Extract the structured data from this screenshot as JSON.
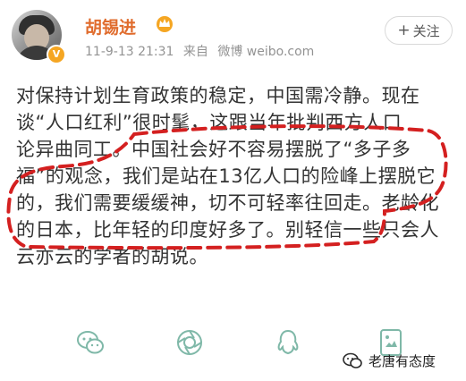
{
  "author": {
    "name": "胡锡进",
    "verified_icon": "verified-badge-icon",
    "vip_icon": "crown-icon"
  },
  "meta": {
    "timestamp": "11-9-13 21:31",
    "source_prefix": "来自",
    "source": "微博 weibo.com"
  },
  "follow_button": {
    "icon": "+",
    "label": "关注"
  },
  "post": {
    "lines": [
      "对保持计划生育政策的稳定，中国需冷静。现在",
      "谈“人口红利”很时髦，这跟当年批判西方人口",
      "论异曲同工。中国社会好不容易摆脱了“多子多",
      "福”的观念，我们是站在13亿人口的险峰上摆脱它",
      "的，我们需要缓缓神，切不可轻率往回走。老龄化",
      "的日本，比年轻的印度好多了。别轻信一些只会人",
      "云亦云的学者的胡说。"
    ]
  },
  "share_icons": [
    "wechat-icon",
    "moments-icon",
    "qq-icon",
    "qzone-icon"
  ],
  "watermark": {
    "text": "老唐有态度"
  },
  "colors": {
    "username": "#e06c2d",
    "annotation": "#d42020",
    "share_icon": "#7fb8a8"
  }
}
